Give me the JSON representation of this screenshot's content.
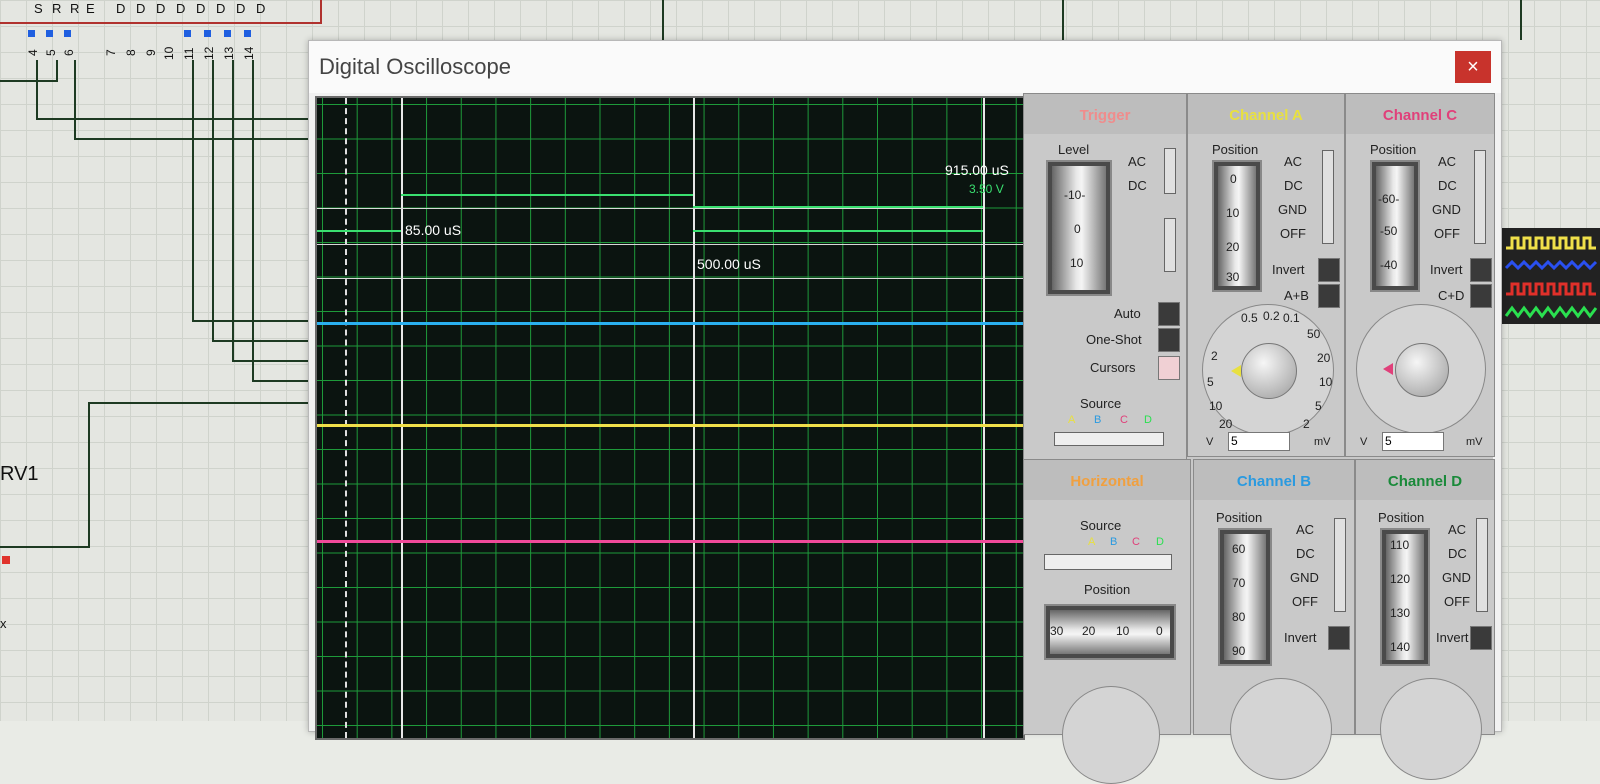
{
  "schematic": {
    "chip_letters": [
      "S",
      "R",
      "R",
      "E",
      "D",
      "D",
      "D",
      "D",
      "D",
      "D",
      "D",
      "D"
    ],
    "pin_numbers": [
      "4",
      "5",
      "6",
      "7",
      "8",
      "9",
      "10",
      "11",
      "12",
      "13",
      "14"
    ],
    "component_label": "RV1",
    "side_label": "x"
  },
  "window": {
    "title": "Digital Oscilloscope",
    "close_label": "×"
  },
  "screen": {
    "cursor_labels": {
      "time_right": "915.00 uS",
      "voltage_right": "3.50 V",
      "time_left": "85.00 uS",
      "time_mid": "500.00 uS"
    },
    "trace_colors": {
      "A": "#f0e04a",
      "B": "#2ab0f0",
      "C": "#f04a9a",
      "D": "#3ae070"
    }
  },
  "trigger": {
    "title": "Trigger",
    "level_label": "Level",
    "level_scale": [
      "-10-",
      "0",
      "10"
    ],
    "coupling": [
      "AC",
      "DC"
    ],
    "auto_label": "Auto",
    "oneshot_label": "One-Shot",
    "cursors_label": "Cursors",
    "source_label": "Source",
    "source_options": [
      "A",
      "B",
      "C",
      "D"
    ]
  },
  "horizontal": {
    "title": "Horizontal",
    "source_label": "Source",
    "source_options": [
      "A",
      "B",
      "C",
      "D"
    ],
    "position_label": "Position",
    "position_scale": [
      "30",
      "20",
      "10",
      "0"
    ]
  },
  "channel_a": {
    "title": "Channel A",
    "position_label": "Position",
    "scale": [
      "0",
      "10",
      "20",
      "30"
    ],
    "modes": [
      "AC",
      "DC",
      "GND",
      "OFF"
    ],
    "invert_label": "Invert",
    "math_label": "A+B",
    "dial_left": [
      "0.5",
      "0.2",
      "0.1",
      "2",
      "5",
      "10",
      "20"
    ],
    "dial_right": [
      "50",
      "20",
      "10",
      "5",
      "2"
    ],
    "unit_v": "V",
    "unit_mv": "mV",
    "volts_value": "5"
  },
  "channel_c": {
    "title": "Channel C",
    "position_label": "Position",
    "scale": [
      "-60-",
      "-50",
      "-40"
    ],
    "modes": [
      "AC",
      "DC",
      "GND",
      "OFF"
    ],
    "invert_label": "Invert",
    "math_label": "C+D",
    "unit_v": "V",
    "unit_mv": "mV",
    "volts_value": "5"
  },
  "channel_b": {
    "title": "Channel B",
    "position_label": "Position",
    "scale": [
      "60",
      "70",
      "80",
      "90"
    ],
    "modes": [
      "AC",
      "DC",
      "GND",
      "OFF"
    ],
    "invert_label": "Invert"
  },
  "channel_d": {
    "title": "Channel D",
    "position_label": "Position",
    "scale": [
      "110",
      "120",
      "130",
      "140"
    ],
    "modes": [
      "AC",
      "DC",
      "GND",
      "OFF"
    ],
    "invert_label": "Invert"
  },
  "colors": {
    "trigger_title": "#f08c8c",
    "horizontal_title": "#f0a040",
    "channel_a_title": "#e8e040",
    "channel_b_title": "#2a9ae0",
    "channel_c_title": "#e0407a",
    "channel_d_title": "#1a8a3a"
  }
}
